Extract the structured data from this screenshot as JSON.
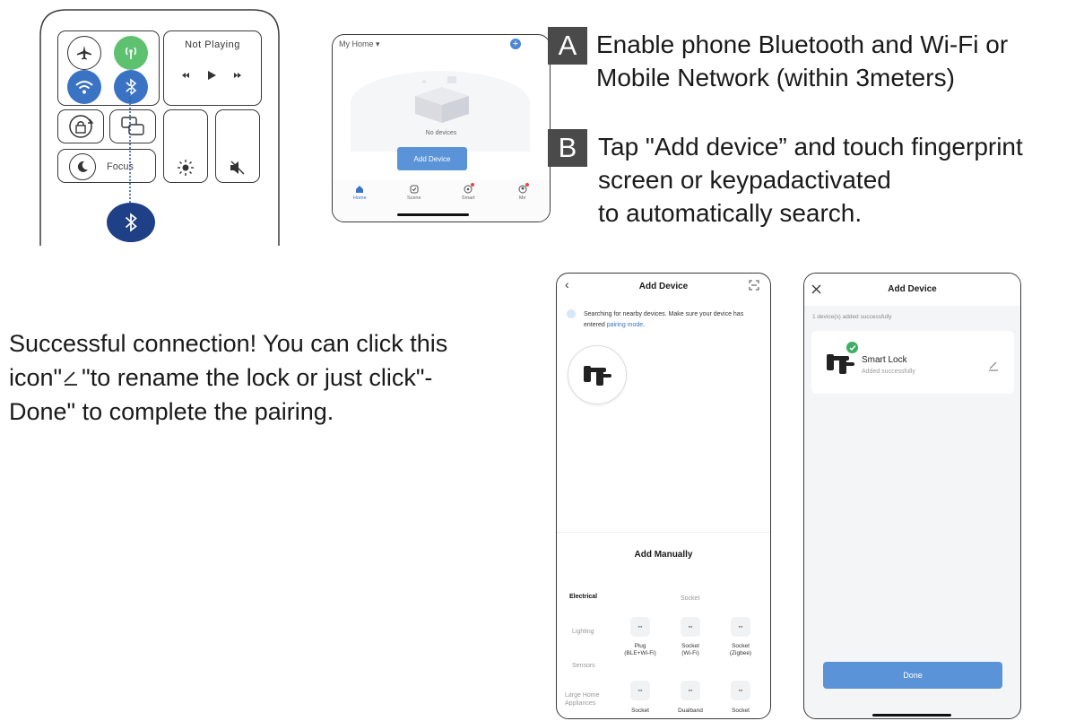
{
  "control_center": {
    "now_playing_label": "Not Playing",
    "focus_label": "Focus",
    "colors": {
      "green": "#5dc170",
      "blue": "#3b73c4",
      "dark_blue": "#1f3f86"
    }
  },
  "home_screen": {
    "home_title": "My Home",
    "empty_text": "No devices",
    "add_button": "Add Device",
    "tabs": [
      {
        "label": "Home",
        "icon": "home-icon"
      },
      {
        "label": "Scene",
        "icon": "scene-icon"
      },
      {
        "label": "Smart",
        "icon": "smart-icon"
      },
      {
        "label": "Me",
        "icon": "me-icon"
      }
    ]
  },
  "steps": {
    "a_badge": "A",
    "a_text": "Enable phone Bluetooth and Wi-Fi or\nMobile  Network (within 3meters)",
    "b_badge": "B",
    "b_text": "Tap \"Add device” and touch fingerprint\nscreen or keypadactivated\nto automatically search."
  },
  "info": {
    "line1": "Successful connection! You can click this",
    "line2_a": "icon\"",
    "line2_b": "\"to rename the lock or just click\"-",
    "line3": "Done\" to complete the pairing."
  },
  "search_screen": {
    "title": "Add Device",
    "searching_text": "Searching for nearby devices. Make sure your device has entered",
    "pairing_link": "pairing mode",
    "add_manually": "Add Manually",
    "categories": [
      "Electrical",
      "Lighting",
      "Sensors",
      "Large Home Appliances"
    ],
    "section_label": "Socket",
    "row1": [
      "Plug\n(BLE+Wi-Fi)",
      "Socket\n(Wi-Fi)",
      "Socket\n(Zigbee)"
    ],
    "row2": [
      "Socket",
      "Dualband",
      "Socket"
    ]
  },
  "done_screen": {
    "title": "Add Device",
    "added_count": "1 device(s) added successfully",
    "device_name": "Smart Lock",
    "device_status": "Added successfully",
    "done_button": "Done"
  }
}
